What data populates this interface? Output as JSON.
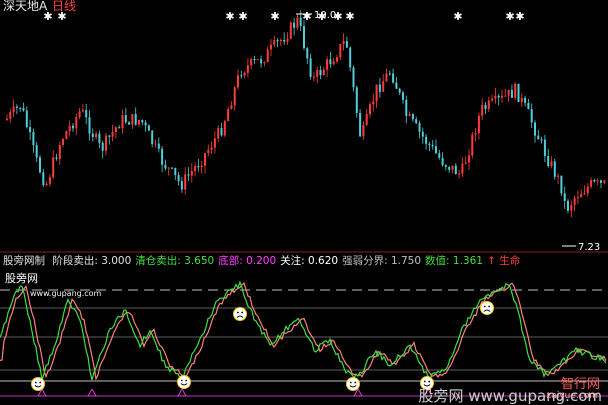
{
  "header": {
    "stock": "深天地A",
    "period": "日线"
  },
  "price_chart": {
    "high_label": "10.0",
    "low_label": "7.23",
    "colors": {
      "up": "#ff3c3c",
      "down": "#4fd0d8",
      "star": "#ffffff",
      "arrow": "#ffffff"
    }
  },
  "indicator": {
    "name": "股旁网制",
    "items": [
      {
        "label": "阶段卖出:",
        "value": "3.000",
        "color": "#e0e0e0"
      },
      {
        "label": "清仓卖出:",
        "value": "3.650",
        "color": "#40e040"
      },
      {
        "label": "底部:",
        "value": "0.200",
        "color": "#ff40ff"
      },
      {
        "label": "关注:",
        "value": "0.620",
        "color": "#ffffff"
      },
      {
        "label": "强弱分界:",
        "value": "1.750",
        "color": "#c0c0c0"
      },
      {
        "label": "数值:",
        "value": "1.361",
        "color": "#40e040"
      },
      {
        "label": "↑ 生命",
        "value": "",
        "color": "#ff4040"
      }
    ],
    "colors": {
      "value_line": "#40e040",
      "signal_line": "#ff8080",
      "dash": "#ffffff",
      "pink": "#ff40ff"
    }
  },
  "site": {
    "label": "股旁网",
    "url": "www.gupang.com"
  },
  "watermark": {
    "text": "股旁网 www.gupang.com",
    "logo": "智行网",
    "logo_sub": "zaiyue.com"
  }
}
